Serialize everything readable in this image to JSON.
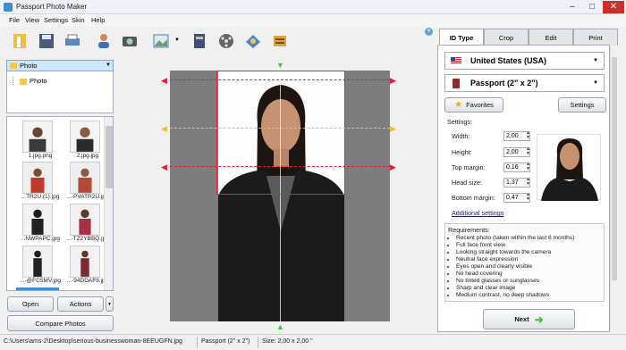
{
  "window": {
    "title": "Passport Photo Maker"
  },
  "menu": [
    "File",
    "View",
    "Settings",
    "Skin",
    "Help"
  ],
  "toolbar": {
    "icons": [
      "wizard-icon",
      "save-icon",
      "print-icon",
      "user-icon",
      "camera-icon",
      "picture-icon",
      "book-icon",
      "film-icon",
      "share-icon",
      "help-icon"
    ]
  },
  "left": {
    "folder_selected": "Photo",
    "tree_item": "Photo",
    "thumbnails": [
      "1.jpg.png",
      "2.jpg.jpg",
      "...TR2U (1).jpg",
      "...-PVATR2U.jpg",
      "...NWPAPC.jpg",
      "...-TZ2YBBQ.jpg",
      "...-@FC5MV.jpg",
      "...-94DDAF8.jpg"
    ],
    "open_label": "Open",
    "actions_label": "Actions",
    "compare_label": "Compare Photos"
  },
  "tabs": [
    "ID Type",
    "Crop",
    "Edit",
    "Print"
  ],
  "idtype": {
    "country": "United States (USA)",
    "document": "Passport (2\" x 2\")",
    "favorites_label": "Favorites",
    "settings_button": "Settings",
    "settings_title": "Settings:",
    "fields": [
      {
        "label": "Width:",
        "value": "2,00"
      },
      {
        "label": "Height:",
        "value": "2,00"
      },
      {
        "label": "Top margin:",
        "value": "0,16"
      },
      {
        "label": "Head size:",
        "value": "1,37"
      },
      {
        "label": "Bottom margin:",
        "value": "0,47"
      }
    ],
    "additional_settings": "Additional settings",
    "requirements_title": "Requirements:",
    "requirements": [
      "Recent photo (taken within the last 6 months)",
      "Full face front view",
      "Looking straight towards the camera",
      "Neutral face expression",
      "Eyes open and clearly visible",
      "No head covering",
      "No tinted glasses or sunglasses",
      "Sharp and clear image",
      "Medium contrast, no deep shadows"
    ],
    "next_label": "Next"
  },
  "status": {
    "path": "C:\\Users\\ams-2\\Desktop\\serious-businesswoman-8EEUGFN.jpg",
    "doc": "Passport (2\" x 2\")",
    "size": "Size: 2,00 x 2,00 ''"
  },
  "colors": {
    "accent": "#3a8fd8",
    "guide_red": "#e02030",
    "guide_yellow": "#f0c030",
    "next_arrow": "#4fbf3a"
  }
}
